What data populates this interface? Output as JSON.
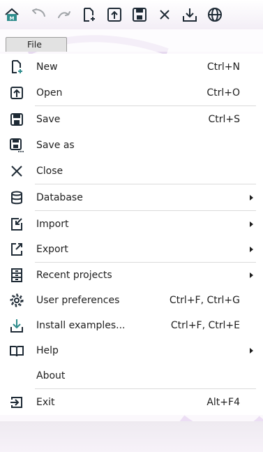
{
  "colors": {
    "icon_dark": "#1e2a35",
    "accent_teal": "#2e8c8c",
    "text": "#1e1e1e",
    "separator": "#dadada"
  },
  "toolbar": {
    "buttons": [
      {
        "icon": "app-logo-icon"
      },
      {
        "icon": "undo-icon"
      },
      {
        "icon": "redo-icon"
      },
      {
        "icon": "new-file-icon"
      },
      {
        "icon": "open-icon"
      },
      {
        "icon": "save-icon"
      },
      {
        "icon": "close-icon"
      },
      {
        "icon": "download-icon"
      },
      {
        "icon": "globe-icon"
      }
    ]
  },
  "menubar": {
    "file_label": "File"
  },
  "menu": {
    "items": [
      {
        "label": "New",
        "shortcut": "Ctrl+N",
        "icon": "new-file-icon"
      },
      {
        "label": "Open",
        "shortcut": "Ctrl+O",
        "icon": "open-icon"
      },
      {
        "label": "Save",
        "shortcut": "Ctrl+S",
        "icon": "save-icon"
      },
      {
        "label": "Save as",
        "shortcut": "",
        "icon": "save-as-icon"
      },
      {
        "label": "Close",
        "shortcut": "",
        "icon": "close-icon"
      },
      {
        "label": "Database",
        "shortcut": "",
        "icon": "database-icon",
        "submenu": true
      },
      {
        "label": "Import",
        "shortcut": "",
        "icon": "import-icon",
        "submenu": true
      },
      {
        "label": "Export",
        "shortcut": "",
        "icon": "export-icon",
        "submenu": true
      },
      {
        "label": "Recent projects",
        "shortcut": "",
        "icon": "recent-projects-icon",
        "submenu": true
      },
      {
        "label": "User preferences",
        "shortcut": "Ctrl+F, Ctrl+G",
        "icon": "gear-icon"
      },
      {
        "label": "Install examples...",
        "shortcut": "Ctrl+F, Ctrl+E",
        "icon": "download-icon"
      },
      {
        "label": "Help",
        "shortcut": "",
        "icon": "book-icon",
        "submenu": true
      },
      {
        "label": "About",
        "shortcut": "",
        "icon": ""
      },
      {
        "label": "Exit",
        "shortcut": "Alt+F4",
        "icon": "exit-icon"
      }
    ]
  }
}
